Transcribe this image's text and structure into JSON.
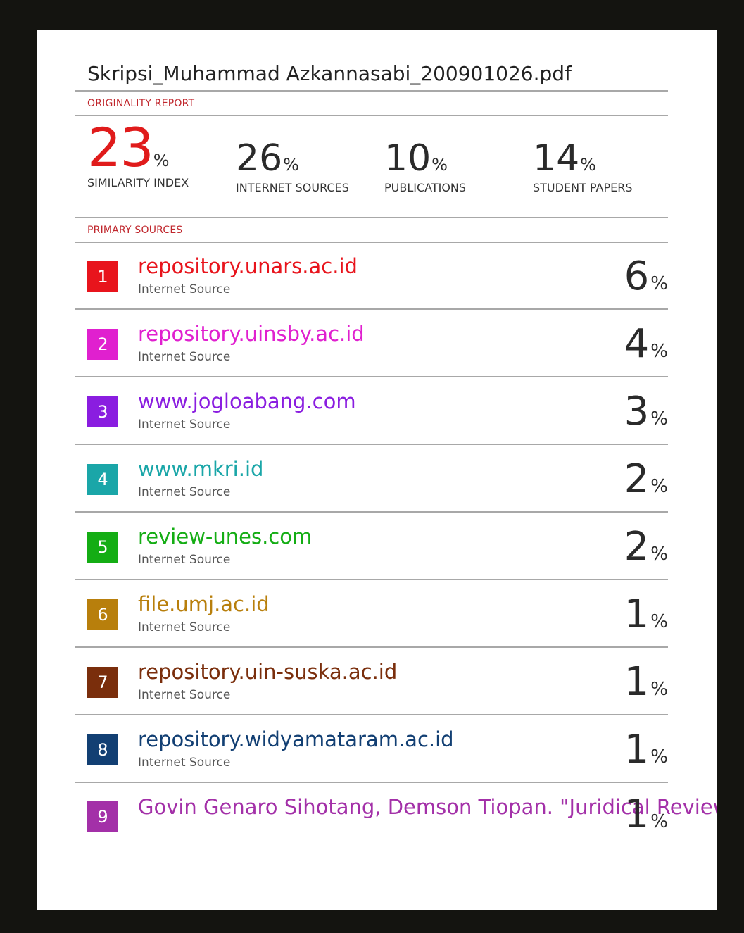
{
  "document": {
    "filename": "Skripsi_Muhammad Azkannasabi_200901026.pdf",
    "originality_label": "ORIGINALITY REPORT",
    "primary_sources_label": "PRIMARY SOURCES"
  },
  "stats": [
    {
      "value": "23",
      "unit": "%",
      "label": "SIMILARITY INDEX"
    },
    {
      "value": "26",
      "unit": "%",
      "label": "INTERNET SOURCES"
    },
    {
      "value": "10",
      "unit": "%",
      "label": "PUBLICATIONS"
    },
    {
      "value": "14",
      "unit": "%",
      "label": "STUDENT PAPERS"
    }
  ],
  "sources": [
    {
      "num": "1",
      "title": "repository.unars.ac.id",
      "type": "Internet Source",
      "percent": "6",
      "unit": "%",
      "color": "#e8141c"
    },
    {
      "num": "2",
      "title": "repository.uinsby.ac.id",
      "type": "Internet Source",
      "percent": "4",
      "unit": "%",
      "color": "#e020cf"
    },
    {
      "num": "3",
      "title": "www.jogloabang.com",
      "type": "Internet Source",
      "percent": "3",
      "unit": "%",
      "color": "#8a1de0"
    },
    {
      "num": "4",
      "title": "www.mkri.id",
      "type": "Internet Source",
      "percent": "2",
      "unit": "%",
      "color": "#1aa6a8"
    },
    {
      "num": "5",
      "title": "review-unes.com",
      "type": "Internet Source",
      "percent": "2",
      "unit": "%",
      "color": "#14ad14"
    },
    {
      "num": "6",
      "title": "file.umj.ac.id",
      "type": "Internet Source",
      "percent": "1",
      "unit": "%",
      "color": "#b87f0c"
    },
    {
      "num": "7",
      "title": "repository.uin-suska.ac.id",
      "type": "Internet Source",
      "percent": "1",
      "unit": "%",
      "color": "#7a2e0c"
    },
    {
      "num": "8",
      "title": "repository.widyamataram.ac.id",
      "type": "Internet Source",
      "percent": "1",
      "unit": "%",
      "color": "#123f73"
    },
    {
      "num": "9",
      "title": "Govin Genaro Sihotang, Demson Tiopan. \"Juridical Review of the Authority of the House of Representatives in Proposing the",
      "type": "",
      "percent": "1",
      "unit": "%",
      "color": "#a330a8"
    }
  ]
}
